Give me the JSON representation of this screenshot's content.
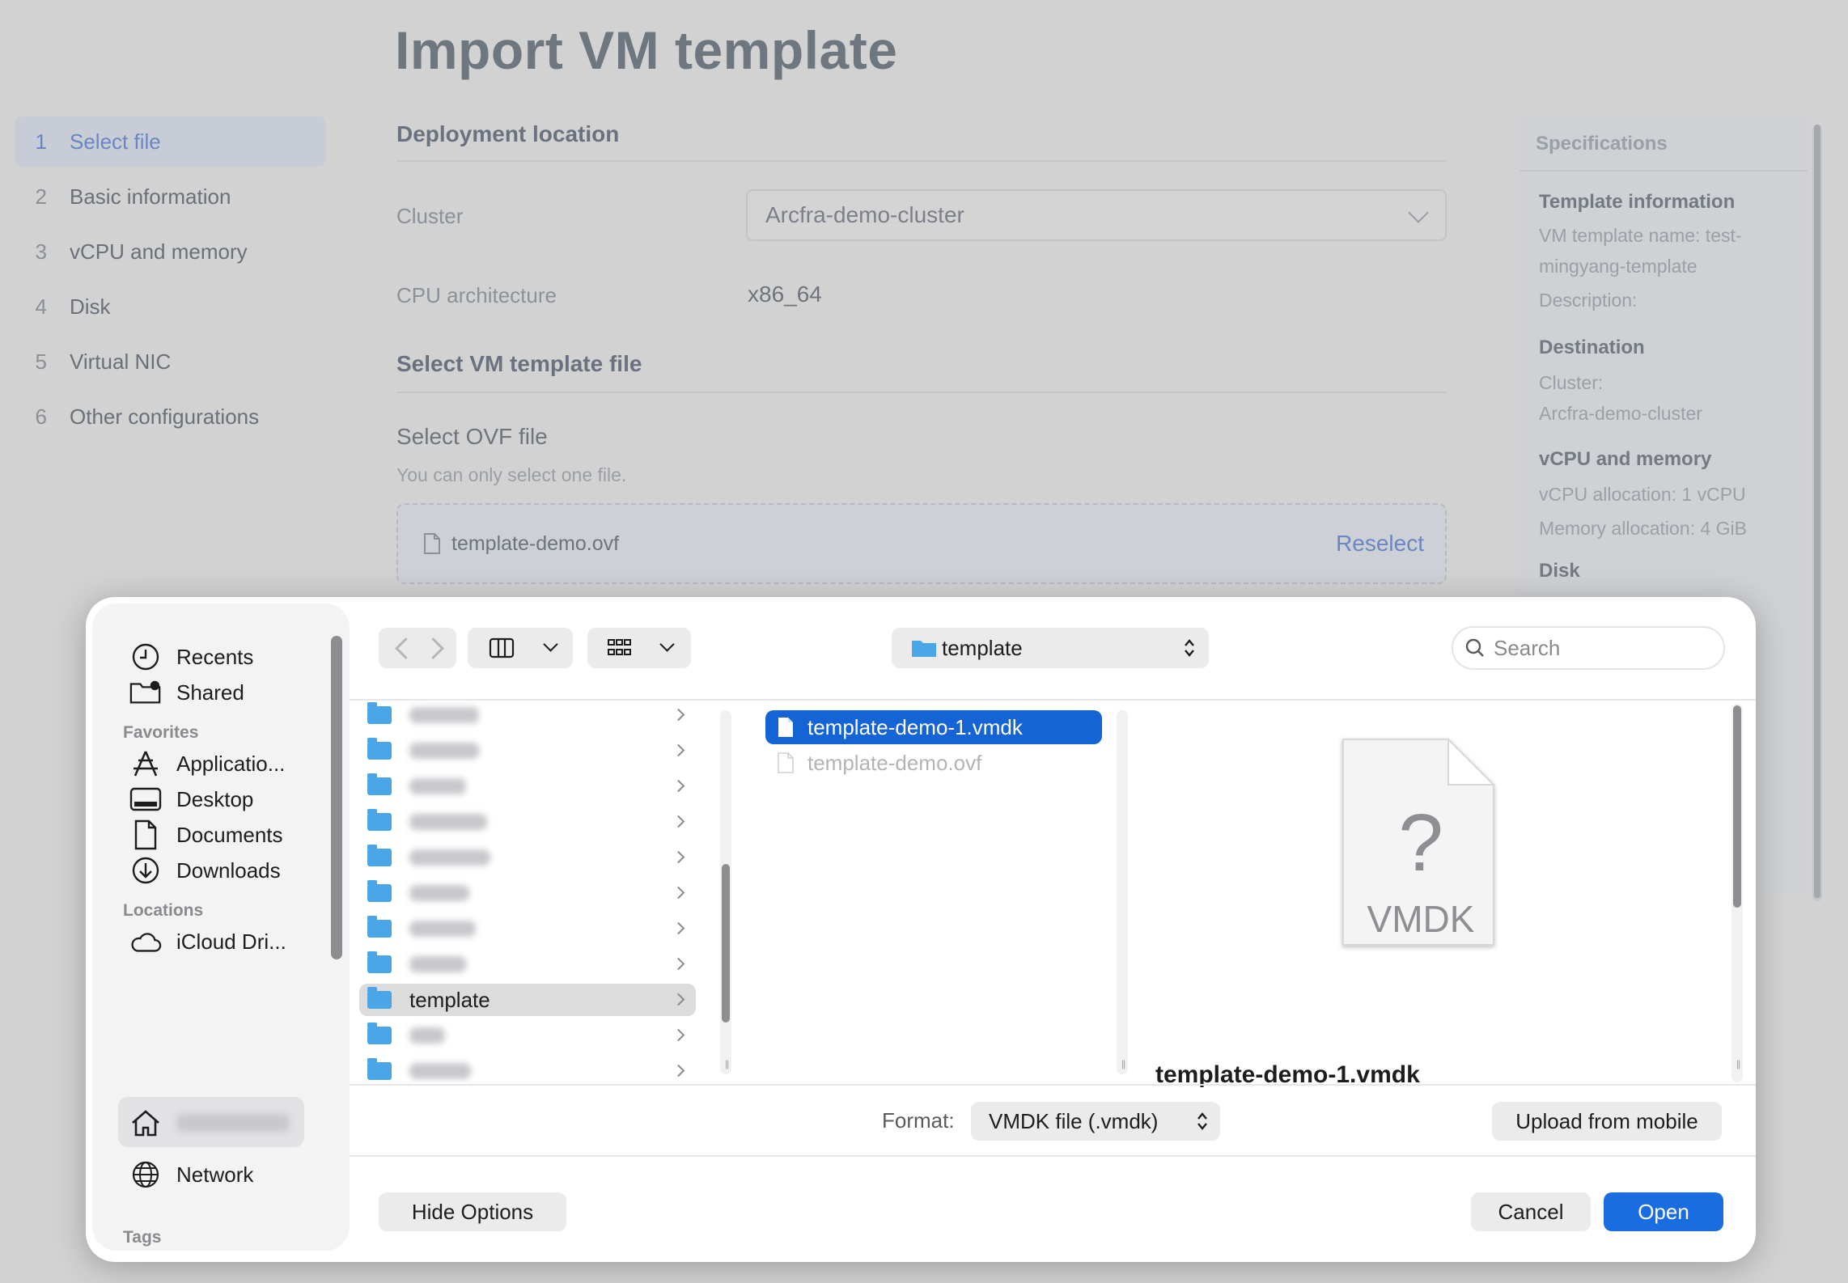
{
  "page": {
    "title": "Import VM template",
    "steps": [
      {
        "num": "1",
        "label": "Select file"
      },
      {
        "num": "2",
        "label": "Basic information"
      },
      {
        "num": "3",
        "label": "vCPU and memory"
      },
      {
        "num": "4",
        "label": "Disk"
      },
      {
        "num": "5",
        "label": "Virtual NIC"
      },
      {
        "num": "6",
        "label": "Other configurations"
      }
    ],
    "deployment_heading": "Deployment location",
    "cluster_label": "Cluster",
    "cluster_value": "Arcfra-demo-cluster",
    "cpu_label": "CPU architecture",
    "cpu_value": "x86_64",
    "template_file_heading": "Select VM template file",
    "ovf_title": "Select OVF file",
    "ovf_hint": "You can only select one file.",
    "selected_file": "template-demo.ovf",
    "reselect_label": "Reselect"
  },
  "specs": {
    "heading": "Specifications",
    "template_info_heading": "Template information",
    "template_name_line1": "VM template name: test-",
    "template_name_line2": "mingyang-template",
    "description": "Description:",
    "destination_heading": "Destination",
    "cluster_line": "Cluster:",
    "cluster_value": "Arcfra-demo-cluster",
    "vcpu_heading": "vCPU and memory",
    "vcpu_alloc": "vCPU allocation: 1 vCPU",
    "mem_alloc": "Memory allocation: 4 GiB",
    "disk_heading": "Disk"
  },
  "dialog": {
    "sidebar": {
      "recents": "Recents",
      "shared": "Shared",
      "favorites_heading": "Favorites",
      "applications": "Applicatio...",
      "desktop": "Desktop",
      "documents": "Documents",
      "downloads": "Downloads",
      "locations_heading": "Locations",
      "icloud": "iCloud Dri...",
      "network": "Network",
      "tags_heading": "Tags"
    },
    "path_folder": "template",
    "search_placeholder": "Search",
    "folder_column_selected": "template",
    "files": [
      {
        "name": "template-demo-1.vmdk",
        "state": "selected"
      },
      {
        "name": "template-demo.ovf",
        "state": "disabled"
      }
    ],
    "preview_type": "VMDK",
    "preview_name": "template-demo-1.vmdk",
    "format_label": "Format:",
    "format_value": "VMDK file (.vmdk)",
    "upload_mobile": "Upload from mobile",
    "hide_options": "Hide Options",
    "cancel": "Cancel",
    "open": "Open"
  },
  "colors": {
    "accent": "#1a6de0",
    "selection": "#1564d6",
    "folder": "#4aa6e6"
  }
}
